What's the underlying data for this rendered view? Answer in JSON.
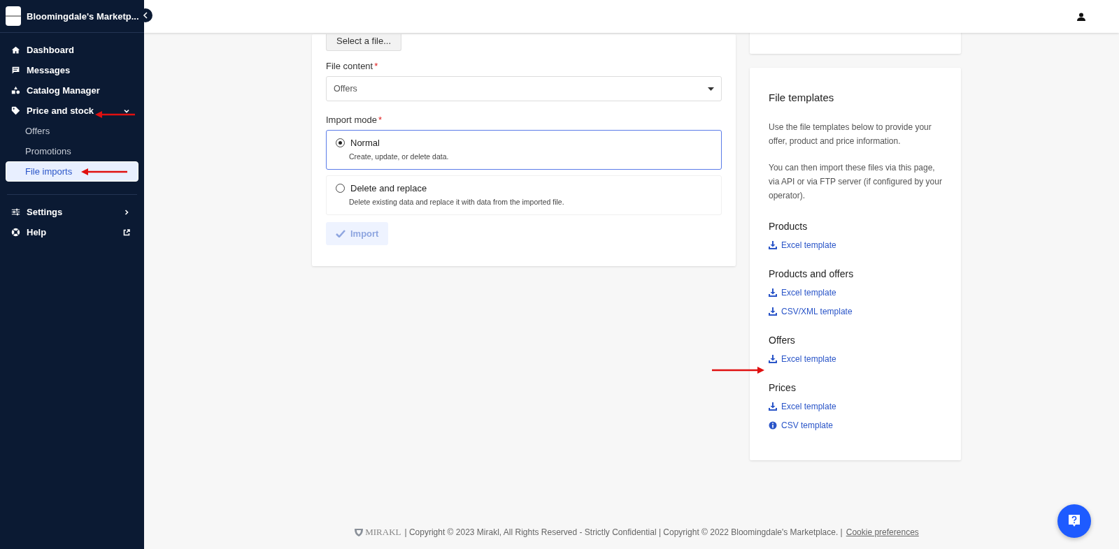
{
  "sidebar": {
    "brand": "Bloomingdale's Marketp...",
    "items": [
      {
        "label": "Dashboard",
        "kind": "page",
        "selected": false
      },
      {
        "label": "Messages",
        "kind": "page",
        "selected": false
      },
      {
        "label": "Catalog Manager",
        "kind": "page",
        "selected": false
      },
      {
        "label": "Price and stock",
        "kind": "group",
        "selected": false,
        "expanded": true,
        "children": [
          {
            "label": "Offers",
            "selected": false
          },
          {
            "label": "Promotions",
            "selected": false
          },
          {
            "label": "File imports",
            "selected": true
          }
        ]
      },
      {
        "label": "Settings",
        "kind": "group",
        "selected": false,
        "expanded": false
      },
      {
        "label": "Help",
        "kind": "external",
        "selected": false
      }
    ]
  },
  "import_form": {
    "select_file_button": "Select a file...",
    "file_content": {
      "label": "File content",
      "required_mark": "*",
      "value": "Offers"
    },
    "import_mode": {
      "label": "Import mode",
      "required_mark": "*",
      "options": [
        {
          "label": "Normal",
          "description": "Create, update, or delete data.",
          "selected": true
        },
        {
          "label": "Delete and replace",
          "description": "Delete existing data and replace it with data from the imported file.",
          "selected": false
        }
      ]
    },
    "import_button": {
      "label": "Import",
      "disabled": true
    }
  },
  "file_templates": {
    "title": "File templates",
    "paragraphs": [
      "Use the file templates below to provide your offer, product and price information.",
      "You can then import these files via this page, via API or via FTP server (if configured by your operator)."
    ],
    "sections": [
      {
        "title": "Products",
        "links": [
          {
            "label": "Excel template",
            "kind": "download"
          }
        ]
      },
      {
        "title": "Products and offers",
        "links": [
          {
            "label": "Excel template",
            "kind": "download"
          },
          {
            "label": "CSV/XML template",
            "kind": "download"
          }
        ]
      },
      {
        "title": "Offers",
        "links": [
          {
            "label": "Excel template",
            "kind": "download"
          }
        ]
      },
      {
        "title": "Prices",
        "links": [
          {
            "label": "Excel template",
            "kind": "download"
          },
          {
            "label": "CSV template",
            "kind": "info"
          }
        ]
      }
    ]
  },
  "footer": {
    "brand": "MIRAKL",
    "text": "| Copyright © 2023 Mirakl, All Rights Reserved - Strictly Confidential | Copyright © 2022 Bloomingdale's Marketplace.  |",
    "link": "Cookie preferences"
  }
}
